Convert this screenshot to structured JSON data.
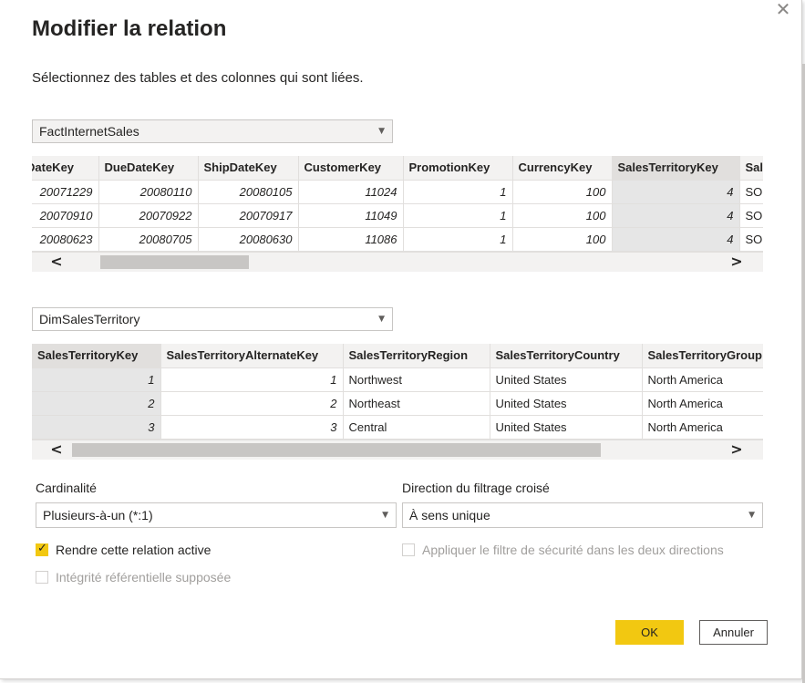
{
  "dialog": {
    "title": "Modifier la relation",
    "subtitle": "Sélectionnez des tables et des colonnes qui sont liées.",
    "close_icon": "close-icon"
  },
  "table1": {
    "selected": "FactInternetSales",
    "columns": [
      "DateKey",
      "DueDateKey",
      "ShipDateKey",
      "CustomerKey",
      "PromotionKey",
      "CurrencyKey",
      "SalesTerritoryKey",
      "Sal"
    ],
    "rows": [
      [
        "20071229",
        "20080110",
        "20080105",
        "11024",
        "1",
        "100",
        "4",
        "SO"
      ],
      [
        "20070910",
        "20070922",
        "20070917",
        "11049",
        "1",
        "100",
        "4",
        "SO"
      ],
      [
        "20080623",
        "20080705",
        "20080630",
        "11086",
        "1",
        "100",
        "4",
        "SO"
      ]
    ]
  },
  "table2": {
    "selected": "DimSalesTerritory",
    "columns": [
      "SalesTerritoryKey",
      "SalesTerritoryAlternateKey",
      "SalesTerritoryRegion",
      "SalesTerritoryCountry",
      "SalesTerritoryGroup"
    ],
    "rows": [
      [
        "1",
        "1",
        "Northwest",
        "United States",
        "North America"
      ],
      [
        "2",
        "2",
        "Northeast",
        "United States",
        "North America"
      ],
      [
        "3",
        "3",
        "Central",
        "United States",
        "North America"
      ]
    ]
  },
  "cardinality": {
    "label": "Cardinalité",
    "value": "Plusieurs-à-un (*:1)"
  },
  "filter_direction": {
    "label": "Direction du filtrage croisé",
    "value": "À sens unique"
  },
  "options": {
    "active_label": "Rendre cette relation active",
    "active_checked": true,
    "security_label": "Appliquer le filtre de sécurité dans les deux directions",
    "security_checked": false,
    "integrity_label": "Intégrité référentielle supposée",
    "integrity_checked": false
  },
  "buttons": {
    "ok": "OK",
    "cancel": "Annuler"
  },
  "colors": {
    "accent": "#f2c811",
    "selected_column": "#e6e6e6",
    "header_bg": "#f3f2f1"
  }
}
